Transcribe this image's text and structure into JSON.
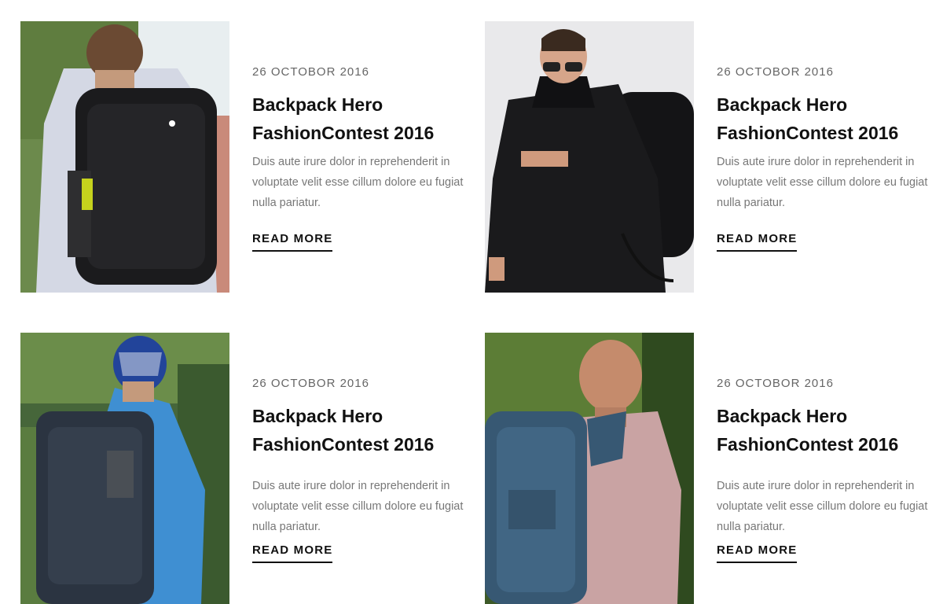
{
  "posts": [
    {
      "date": "26 OCTOBOR 2016",
      "title_line1": "Backpack Hero",
      "title_line2": "FashionContest 2016",
      "excerpt": "Duis aute irure dolor in reprehenderit in voluptate velit esse cillum dolore eu fugiat nulla pariatur.",
      "read_more": "READ MORE"
    },
    {
      "date": "26 OCTOBOR 2016",
      "title_line1": "Backpack Hero",
      "title_line2": "FashionContest 2016",
      "excerpt": "Duis aute irure dolor in reprehenderit in voluptate velit esse cillum dolore eu fugiat nulla pariatur.",
      "read_more": "READ MORE"
    },
    {
      "date": "26 OCTOBOR 2016",
      "title_line1": "Backpack Hero",
      "title_line2": "FashionContest 2016",
      "excerpt": "Duis aute irure dolor in reprehenderit in voluptate velit esse cillum dolore eu fugiat nulla pariatur.",
      "read_more": "READ MORE"
    },
    {
      "date": "26 OCTOBOR 2016",
      "title_line1": "Backpack Hero",
      "title_line2": "FashionContest 2016",
      "excerpt": "Duis aute irure dolor in reprehenderit in voluptate velit esse cillum dolore eu fugiat nulla pariatur.",
      "read_more": "READ MORE"
    }
  ]
}
